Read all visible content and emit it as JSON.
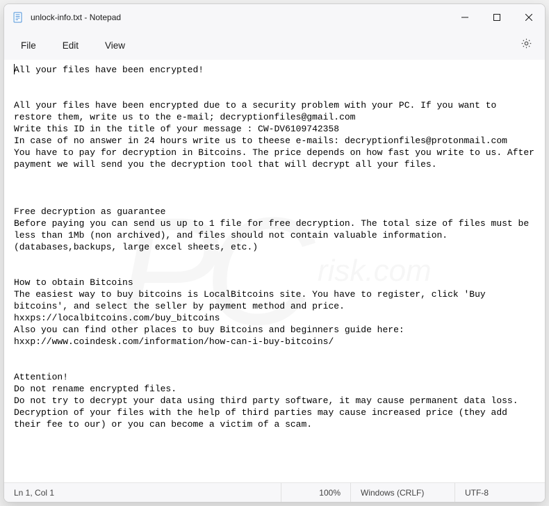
{
  "titlebar": {
    "title": "unlock-info.txt - Notepad"
  },
  "menubar": {
    "file": "File",
    "edit": "Edit",
    "view": "View"
  },
  "document": {
    "text": "All your files have been encrypted!\n\n\nAll your files have been encrypted due to a security problem with your PC. If you want to restore them, write us to the e-mail; decryptionfiles@gmail.com\nWrite this ID in the title of your message : CW-DV6109742358\nIn case of no answer in 24 hours write us to theese e-mails: decryptionfiles@protonmail.com\nYou have to pay for decryption in Bitcoins. The price depends on how fast you write to us. After payment we will send you the decryption tool that will decrypt all your files.\n\n\n\nFree decryption as guarantee\nBefore paying you can send us up to 1 file for free decryption. The total size of files must be less than 1Mb (non archived), and files should not contain valuable information. (databases,backups, large excel sheets, etc.)\n\n\nHow to obtain Bitcoins\nThe easiest way to buy bitcoins is LocalBitcoins site. You have to register, click 'Buy bitcoins', and select the seller by payment method and price.\nhxxps://localbitcoins.com/buy_bitcoins\nAlso you can find other places to buy Bitcoins and beginners guide here:\nhxxp://www.coindesk.com/information/how-can-i-buy-bitcoins/\n\n\nAttention!\nDo not rename encrypted files.\nDo not try to decrypt your data using third party software, it may cause permanent data loss.\nDecryption of your files with the help of third parties may cause increased price (they add their fee to our) or you can become a victim of a scam."
  },
  "statusbar": {
    "cursor": "Ln 1, Col 1",
    "zoom": "100%",
    "line_ending": "Windows (CRLF)",
    "encoding": "UTF-8"
  },
  "watermark": {
    "icon_text": "PC",
    "sub_text": "risk.com"
  }
}
